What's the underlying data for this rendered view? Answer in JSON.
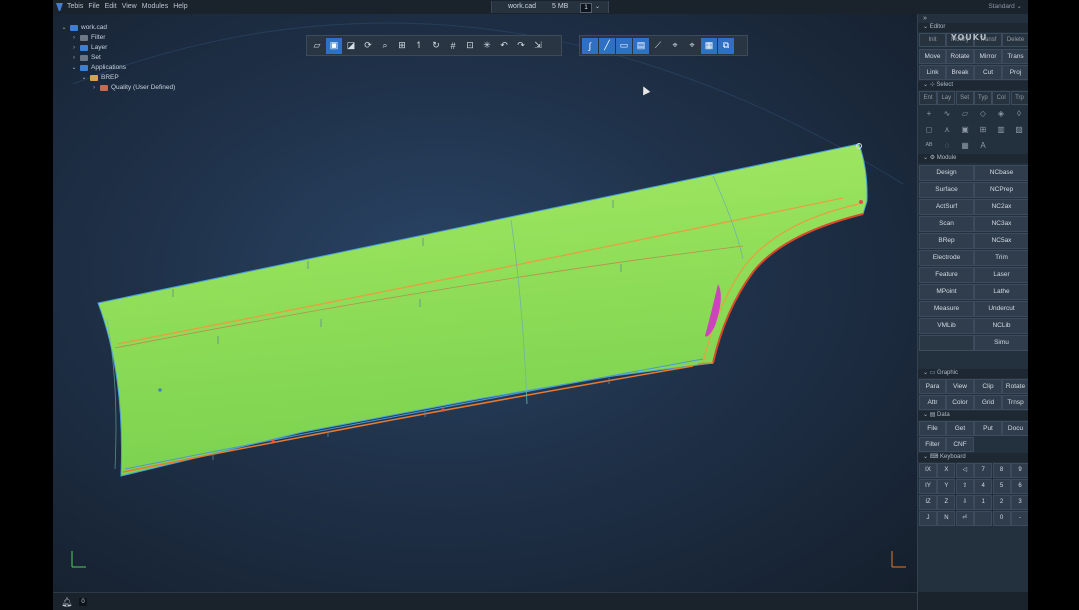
{
  "menubar": {
    "items": [
      "Tebis",
      "File",
      "Edit",
      "View",
      "Modules",
      "Help"
    ],
    "doc_name": "work.cad",
    "doc_size": "5 MB",
    "page_num": "1",
    "profile": "Standard"
  },
  "tree": {
    "root": "work.cad",
    "children": [
      "Filter",
      "Layer",
      "Set",
      "Applications"
    ],
    "brep": "BREP",
    "quality": "Quality (User Defined)"
  },
  "toolbar1_icons": [
    "cube-icon",
    "surface-icon",
    "shade-icon",
    "rotate-icon",
    "zoom-icon",
    "fit-icon",
    "axis-icon",
    "refresh-icon",
    "grid-icon",
    "frame-icon",
    "perspective-icon",
    "turn-icon",
    "pan-icon",
    "snap-icon"
  ],
  "toolbar2_icons": [
    "curve-icon",
    "line-icon",
    "plane-icon",
    "plane-active-icon",
    "measure-icon",
    "pick-icon",
    "pick2-icon",
    "pick3-icon",
    "pick4-icon"
  ],
  "sidebar": {
    "edit_header": "Editor",
    "edit_top": [
      "Init",
      "Modify",
      "Transf",
      "Delete"
    ],
    "edit_row1": [
      "Move",
      "Rotate",
      "Mirror",
      "Trans"
    ],
    "edit_row2": [
      "Link",
      "Break",
      "Cut",
      "Proj"
    ],
    "select_header": "Select",
    "select_row": [
      "Ent",
      "Lay",
      "Set",
      "Typ",
      "Col",
      "Trp"
    ],
    "module_header": "Module",
    "module_rows": [
      [
        "Design",
        "NCbase"
      ],
      [
        "Surface",
        "NCPrep"
      ],
      [
        "ActSurf",
        "NC2ax"
      ],
      [
        "Scan",
        "NC3ax"
      ],
      [
        "BRep",
        "NC5ax"
      ],
      [
        "Electrode",
        "Trim"
      ],
      [
        "Feature",
        "Laser"
      ],
      [
        "MPoint",
        "Lathe"
      ],
      [
        "Measure",
        "Undercut"
      ],
      [
        "VMLib",
        "NCLib"
      ],
      [
        "",
        "Simu"
      ]
    ],
    "graphic_header": "Graphic",
    "graphic_row1": [
      "Para",
      "View",
      "Clip",
      "Rotate"
    ],
    "graphic_row2": [
      "Attr",
      "Color",
      "Grid",
      "Trnsp"
    ],
    "data_header": "Data",
    "data_row1": [
      "File",
      "Get",
      "Put",
      "Docu"
    ],
    "data_row2": [
      "Filter",
      "CNF"
    ],
    "keyboard_header": "Keyboard",
    "keys": [
      [
        "IX",
        "X",
        "◁",
        "7",
        "8",
        "9"
      ],
      [
        "IY",
        "Y",
        "⇧",
        "4",
        "5",
        "6"
      ],
      [
        "IZ",
        "Z",
        "⇩",
        "1",
        "2",
        "3"
      ],
      [
        "J",
        "N",
        "⏎",
        "",
        "0",
        "-"
      ]
    ]
  },
  "watermark": "YOUKU",
  "bottom": {
    "count": "0"
  },
  "colors": {
    "accent": "#2f6fc4",
    "surface_green": "#8fe05a",
    "background": "#1f3149"
  }
}
